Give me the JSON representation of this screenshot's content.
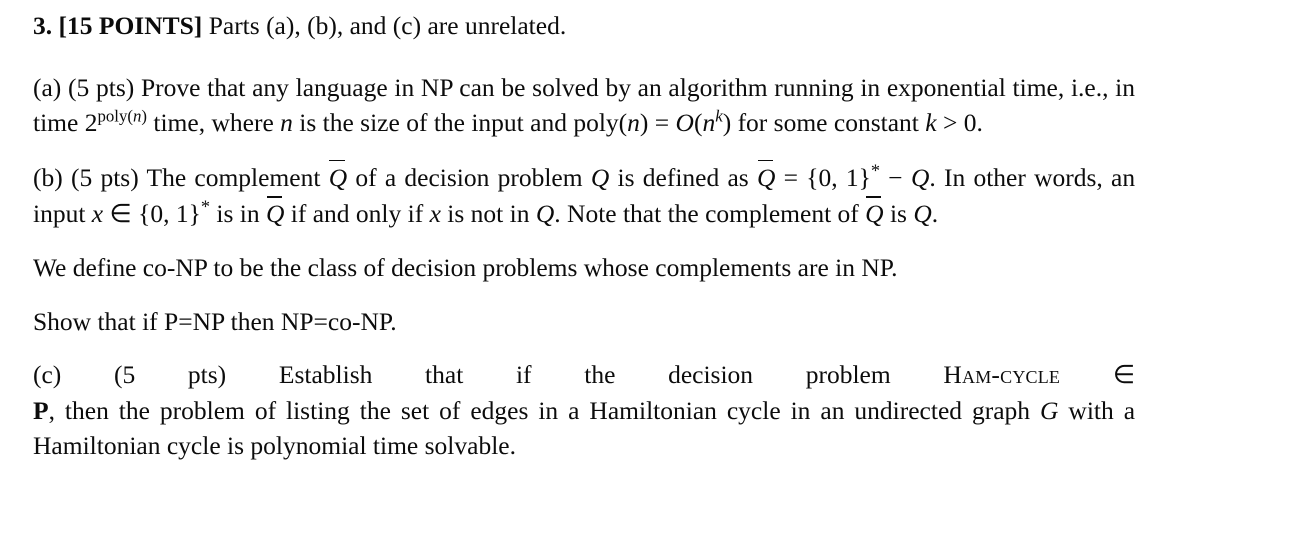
{
  "document": {
    "problem_number": "3.",
    "points_label": "[15 POINTS]",
    "intro_text": "Parts (a), (b), and (c) are unrelated.",
    "parts": {
      "a": {
        "marker": "(a)",
        "points": "(5 pts)",
        "text_1": "Prove that any language in NP can be solved by an algorithm running in exponential time, i.e., in time",
        "base": "2",
        "exponent_poly": "poly",
        "exponent_open": "(",
        "exponent_var": "n",
        "exponent_close": ")",
        "text_2": "time, where",
        "var_n": "n",
        "text_3": "is the size of the input and poly(",
        "var_n2": "n",
        "text_4": ") =",
        "bigo": "O",
        "bigo_open": "(",
        "bigo_var": "n",
        "bigo_exp": "k",
        "bigo_close": ")",
        "text_5": "for some constant",
        "var_k": "k",
        "text_6": "> 0."
      },
      "b": {
        "marker": "(b)",
        "points": "(5 pts)",
        "text_1": "The complement",
        "qbar_1": "Q",
        "text_2": "of a decision problem",
        "var_q_1": "Q",
        "text_3": "is defined as",
        "qbar_2": "Q",
        "equals": "=",
        "set_open": "{0, 1}",
        "set_star": "*",
        "minus": "−",
        "var_q_2": "Q",
        "period_1": ".",
        "text_4": "In other words, an input",
        "var_x_1": "x",
        "elem_of": "∈",
        "set_open_2": "{0, 1}",
        "set_star_2": "*",
        "text_5": "is in",
        "qbar_3": "Q",
        "text_6": "if and only if",
        "var_x_2": "x",
        "text_7": "is not in",
        "var_q_3": "Q",
        "text_8": ". Note that the complement of",
        "qbar_4": "Q",
        "text_9": "is",
        "var_q_4": "Q",
        "period_2": "."
      },
      "conp_definition": "We define co-NP to be the class of decision problems whose complements are in NP.",
      "show_statement": "Show that if P=NP then NP=co-NP.",
      "c": {
        "marker": "(c)",
        "points": "(5 pts)",
        "text_1": "Establish that if the decision problem",
        "problem_name": "Ham-cycle",
        "elem_of": "∈",
        "class_p": "P",
        "text_2": ", then the problem of listing the set of edges in a Hamiltonian cycle in an undirected graph",
        "var_g": "G",
        "text_3": "with a Hamiltonian cycle is polynomial time solvable."
      }
    }
  },
  "style": {
    "text_color": "#0c0c0c",
    "background_color": "#ffffff"
  }
}
